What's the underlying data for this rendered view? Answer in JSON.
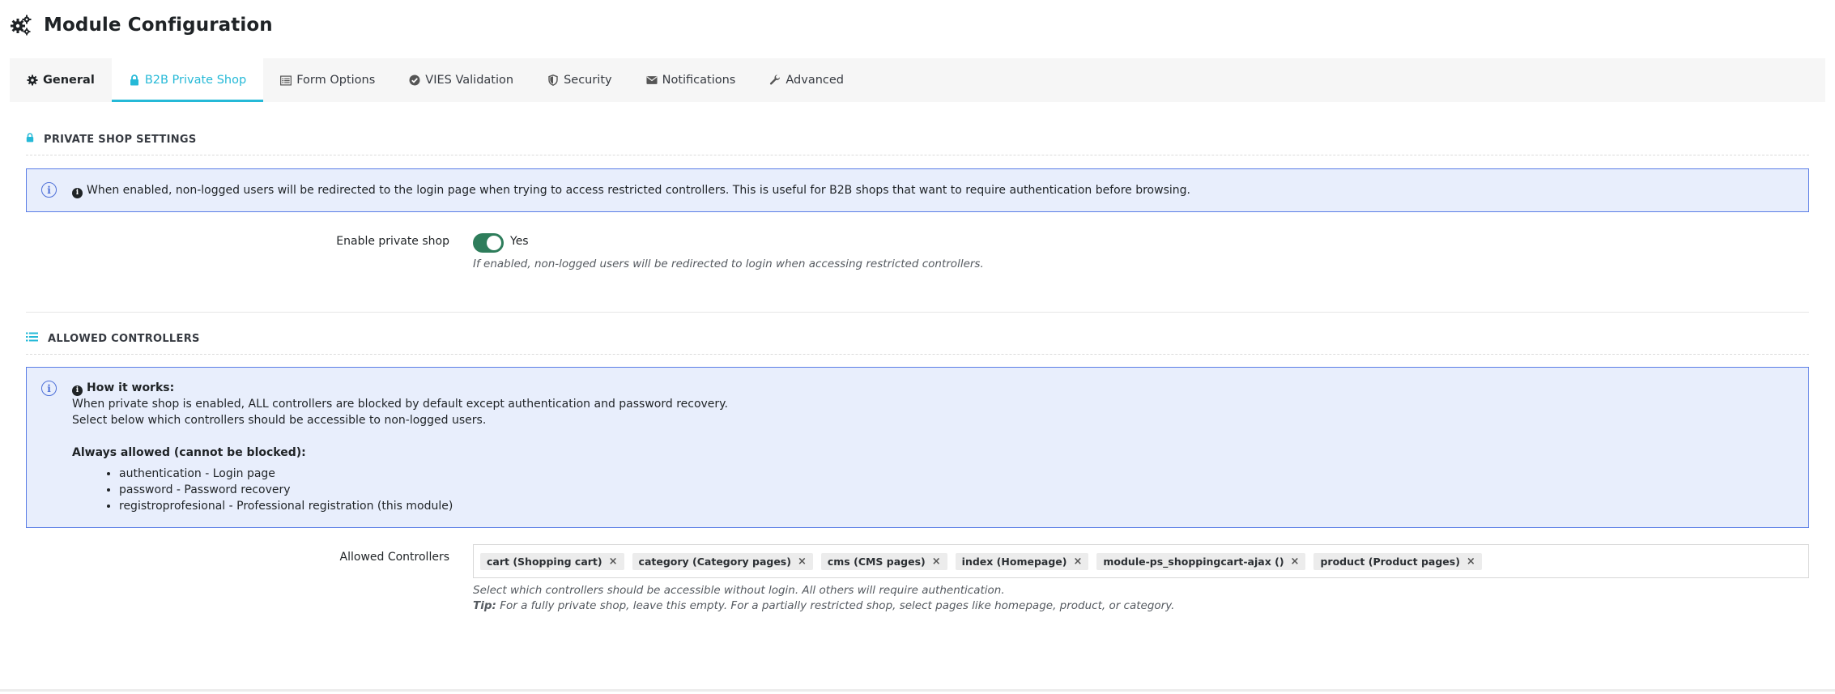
{
  "header": {
    "title": "Module Configuration",
    "icon": "cogs-icon"
  },
  "tabs": [
    {
      "label": "General",
      "icon": "gear-icon"
    },
    {
      "label": "B2B Private Shop",
      "icon": "lock-icon"
    },
    {
      "label": "Form Options",
      "icon": "list-alt-icon"
    },
    {
      "label": "VIES Validation",
      "icon": "check-circle-icon"
    },
    {
      "label": "Security",
      "icon": "shield-icon"
    },
    {
      "label": "Notifications",
      "icon": "envelope-icon"
    },
    {
      "label": "Advanced",
      "icon": "wrench-icon"
    }
  ],
  "active_tab": "B2B Private Shop",
  "private_shop": {
    "section_title": "PRIVATE SHOP SETTINGS",
    "alert": "When enabled, non-logged users will be redirected to the login page when trying to access restricted controllers. This is useful for B2B shops that want to require authentication before browsing.",
    "enable_label": "Enable private shop",
    "toggle_value": "Yes",
    "help": "If enabled, non-logged users will be redirected to login when accessing restricted controllers."
  },
  "allowed": {
    "section_title": "ALLOWED CONTROLLERS",
    "how_title": "How it works:",
    "how_line1": "When private shop is enabled, ALL controllers are blocked by default except authentication and password recovery.",
    "how_line2": "Select below which controllers should be accessible to non-logged users.",
    "always_title": "Always allowed (cannot be blocked):",
    "always_items": [
      "authentication - Login page",
      "password - Password recovery",
      "registroprofesional - Professional registration (this module)"
    ],
    "field_label": "Allowed Controllers",
    "tags": [
      "cart (Shopping cart)",
      "category (Category pages)",
      "cms (CMS pages)",
      "index (Homepage)",
      "module-ps_shoppingcart-ajax ()",
      "product (Product pages)"
    ],
    "help1": "Select which controllers should be accessible without login. All others will require authentication.",
    "tip_label": "Tip:",
    "help2": "For a fully private shop, leave this empty. For a partially restricted shop, select pages like homepage, product, or category."
  },
  "colors": {
    "accent": "#25b9d7",
    "toggle_on": "#2e7d5b",
    "alert_bg": "#e8eefc",
    "alert_border": "#5a7de6"
  }
}
